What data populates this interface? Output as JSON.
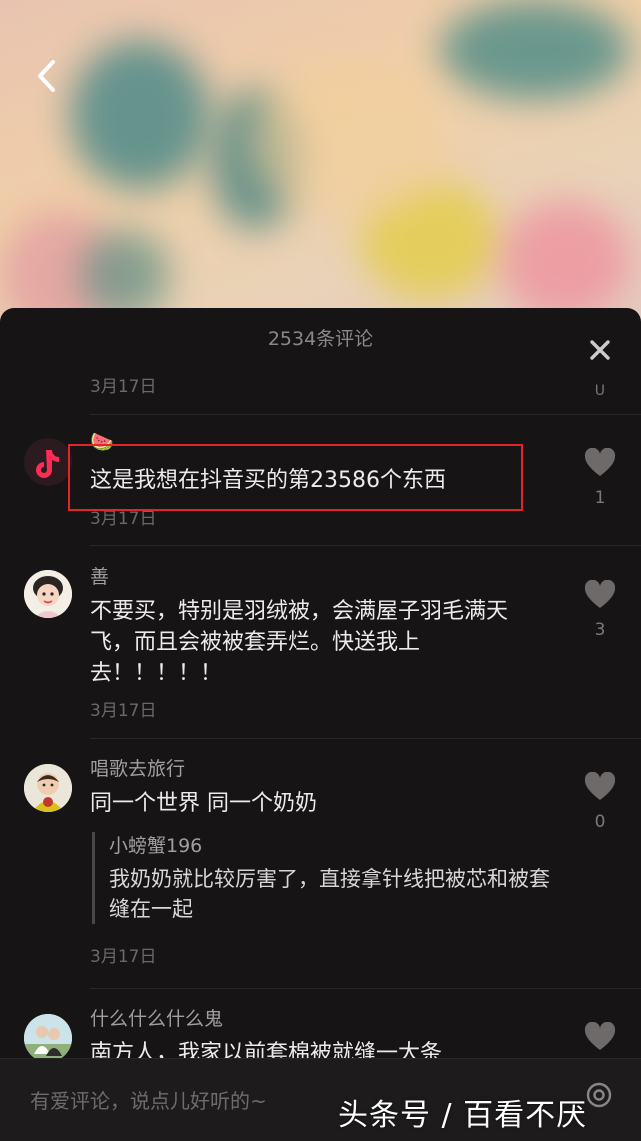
{
  "panel": {
    "title": "2534条评论",
    "scroll_hint": "U"
  },
  "first_date": "3月17日",
  "comments": [
    {
      "username": "🍉",
      "text": "这是我想在抖音买的第23586个东西",
      "date": "3月17日",
      "likes": "1",
      "avatar_icon": "tiktok-music-note-icon"
    },
    {
      "username": "善",
      "text": "不要买，特别是羽绒被，会满屋子羽毛满天飞，而且会被被套弄烂。快送我上去！！！！！",
      "date": "3月17日",
      "likes": "3",
      "avatar_icon": "girl-avatar"
    },
    {
      "username": "唱歌去旅行",
      "text": "同一个世界 同一个奶奶",
      "reply": {
        "username": "小螃蟹196",
        "text": "我奶奶就比较厉害了，直接拿针线把被芯和被套缝在一起"
      },
      "date": "3月17日",
      "likes": "0",
      "avatar_icon": "child-avatar"
    },
    {
      "username": "什么什么什么鬼",
      "text": "南方人，我家以前套棉被就缝一大条",
      "likes": "",
      "avatar_icon": "couple-avatar"
    }
  ],
  "input": {
    "placeholder": "有爱评论，说点儿好听的~"
  },
  "watermark": "头条号 / 百看不厌",
  "colors": {
    "highlight": "#e0262b",
    "panel_bg": "#161414",
    "tiktok_red": "#fe2c55"
  }
}
